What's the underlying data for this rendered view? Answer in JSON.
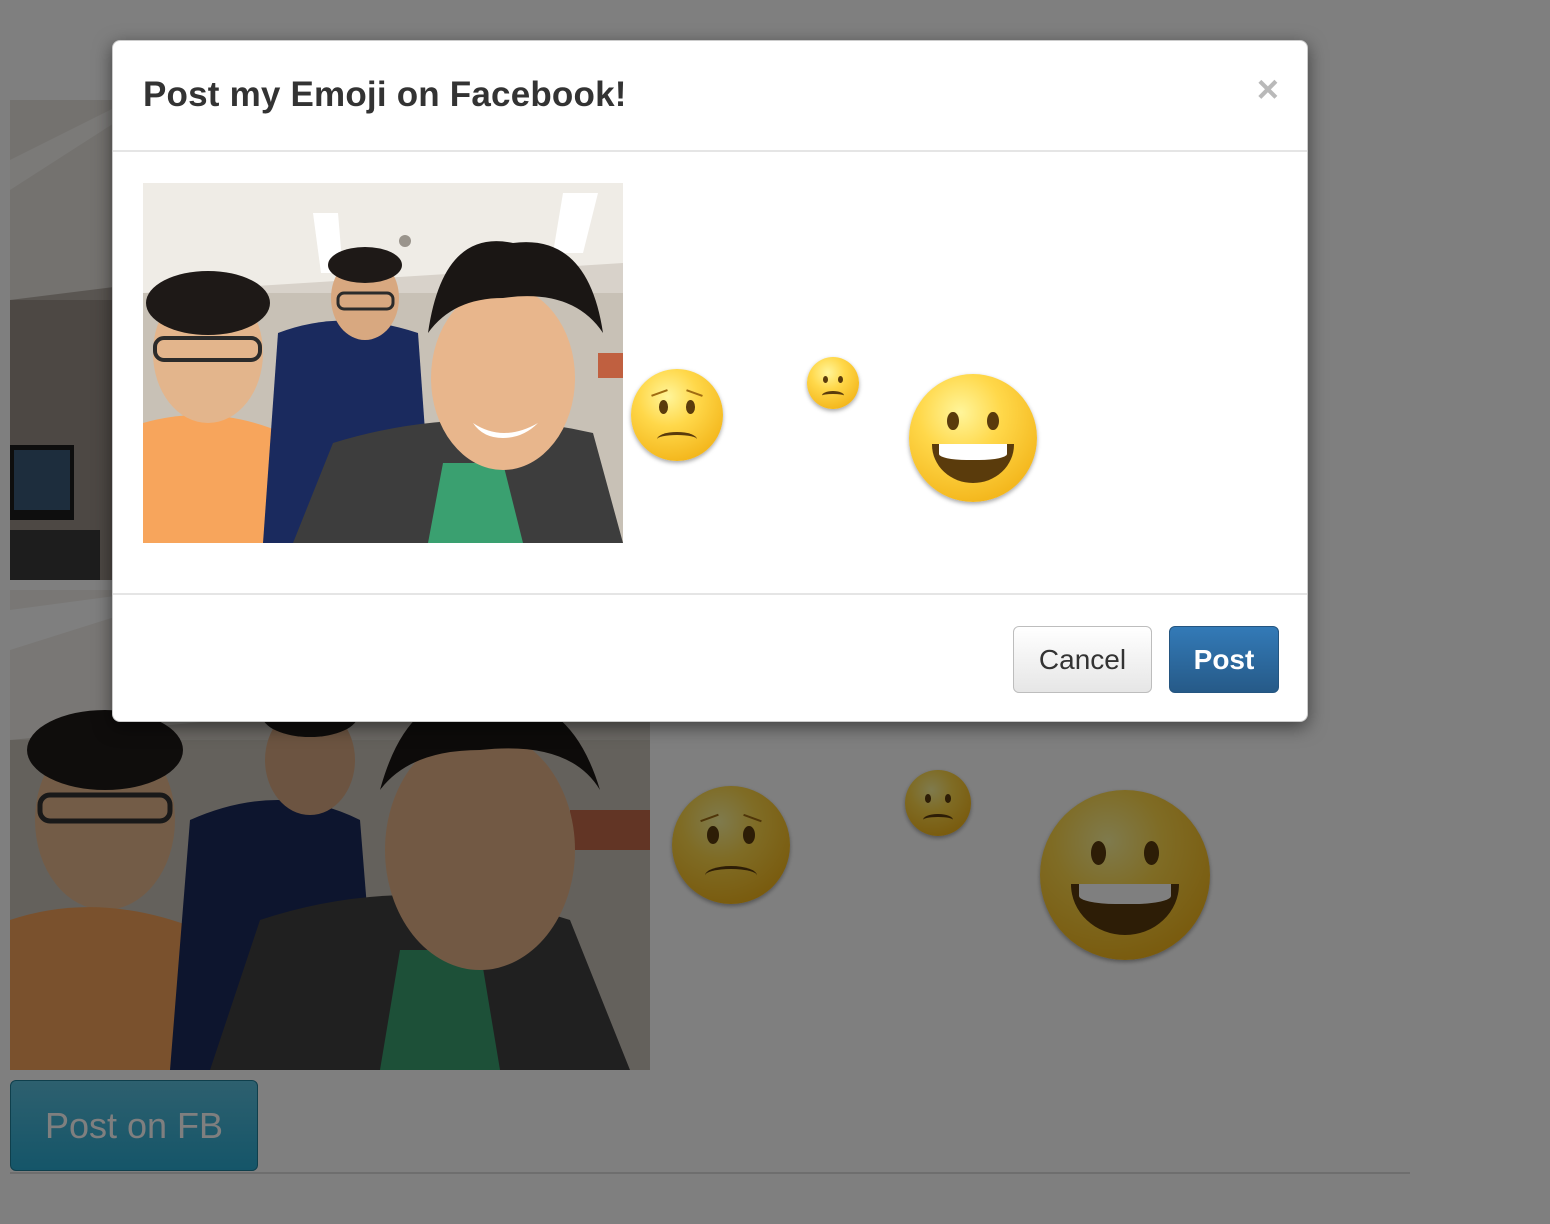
{
  "page": {
    "post_fb_button_label": "Post on FB"
  },
  "modal": {
    "title": "Post my Emoji on Facebook!",
    "close_glyph": "×",
    "cancel_label": "Cancel",
    "post_label": "Post"
  },
  "emojis": {
    "modal": [
      "worried-face-emoji",
      "worried-face-emoji",
      "grinning-face-emoji"
    ],
    "background": [
      "worried-face-emoji",
      "worried-face-emoji",
      "grinning-face-emoji"
    ]
  },
  "colors": {
    "post_button": "#337ab7",
    "post_fb_button": "#5bc0de",
    "backdrop": "rgba(0,0,0,0.5)"
  }
}
